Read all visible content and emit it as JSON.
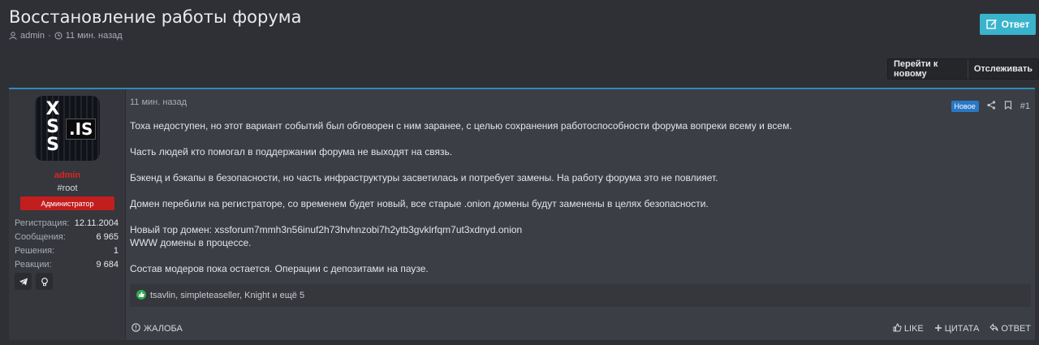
{
  "thread": {
    "title": "Восстановление работы форума",
    "author": "admin",
    "time": "11 мин. назад"
  },
  "header": {
    "reply_label": "Ответ",
    "goto_new_label": "Перейти к новому",
    "watch_label": "Отслеживать"
  },
  "user": {
    "name": "admin",
    "title": "#root",
    "role": "Администратор",
    "stats": [
      {
        "key": "Регистрация:",
        "value": "12.11.2004"
      },
      {
        "key": "Сообщения:",
        "value": "6 965"
      },
      {
        "key": "Решения:",
        "value": "1"
      },
      {
        "key": "Реакции:",
        "value": "9 684"
      }
    ],
    "avatar_text_1": "XSS",
    "avatar_text_2": ".IS"
  },
  "post": {
    "date": "11 мин. назад",
    "badge": "Новое",
    "number": "#1",
    "paragraphs": [
      "Тоха недоступен, но этот вариант событий был обговорен с ним заранее, с целью сохранения работоспособности форума вопреки всему и всем.",
      "Часть людей кто помогал в поддержании форума не выходят на связь.",
      "Бэкенд и бэкапы в безопасности, но часть инфраструктуры засветилась и потребует замены. На работу форума это не повлияет.",
      "Домен перебили на регистраторе, со временем будет новый, все старые .onion домены будут заменены в целях безопасности.",
      "Новый тор домен: xssforum7mmh3n56inuf2h73hvhnzobi7h2ytb3gvklrfqm7ut3xdnyd.onion",
      "WWW домены в процессе.",
      "Состав модеров пока остается. Операции с депозитами на паузе."
    ],
    "reactions": "tsavlin, simpleteaseller, Knight и ещё 5"
  },
  "footer": {
    "report_label": "ЖАЛОБА",
    "like_label": "LIKE",
    "quote_label": "ЦИТАТА",
    "reply_label": "ОТВЕТ"
  },
  "colors": {
    "accent": "#3ab3cc",
    "role_badge": "#c21e1e",
    "username": "#e02424",
    "new_badge": "#2a78c5",
    "post_border": "#2f8ab8"
  }
}
